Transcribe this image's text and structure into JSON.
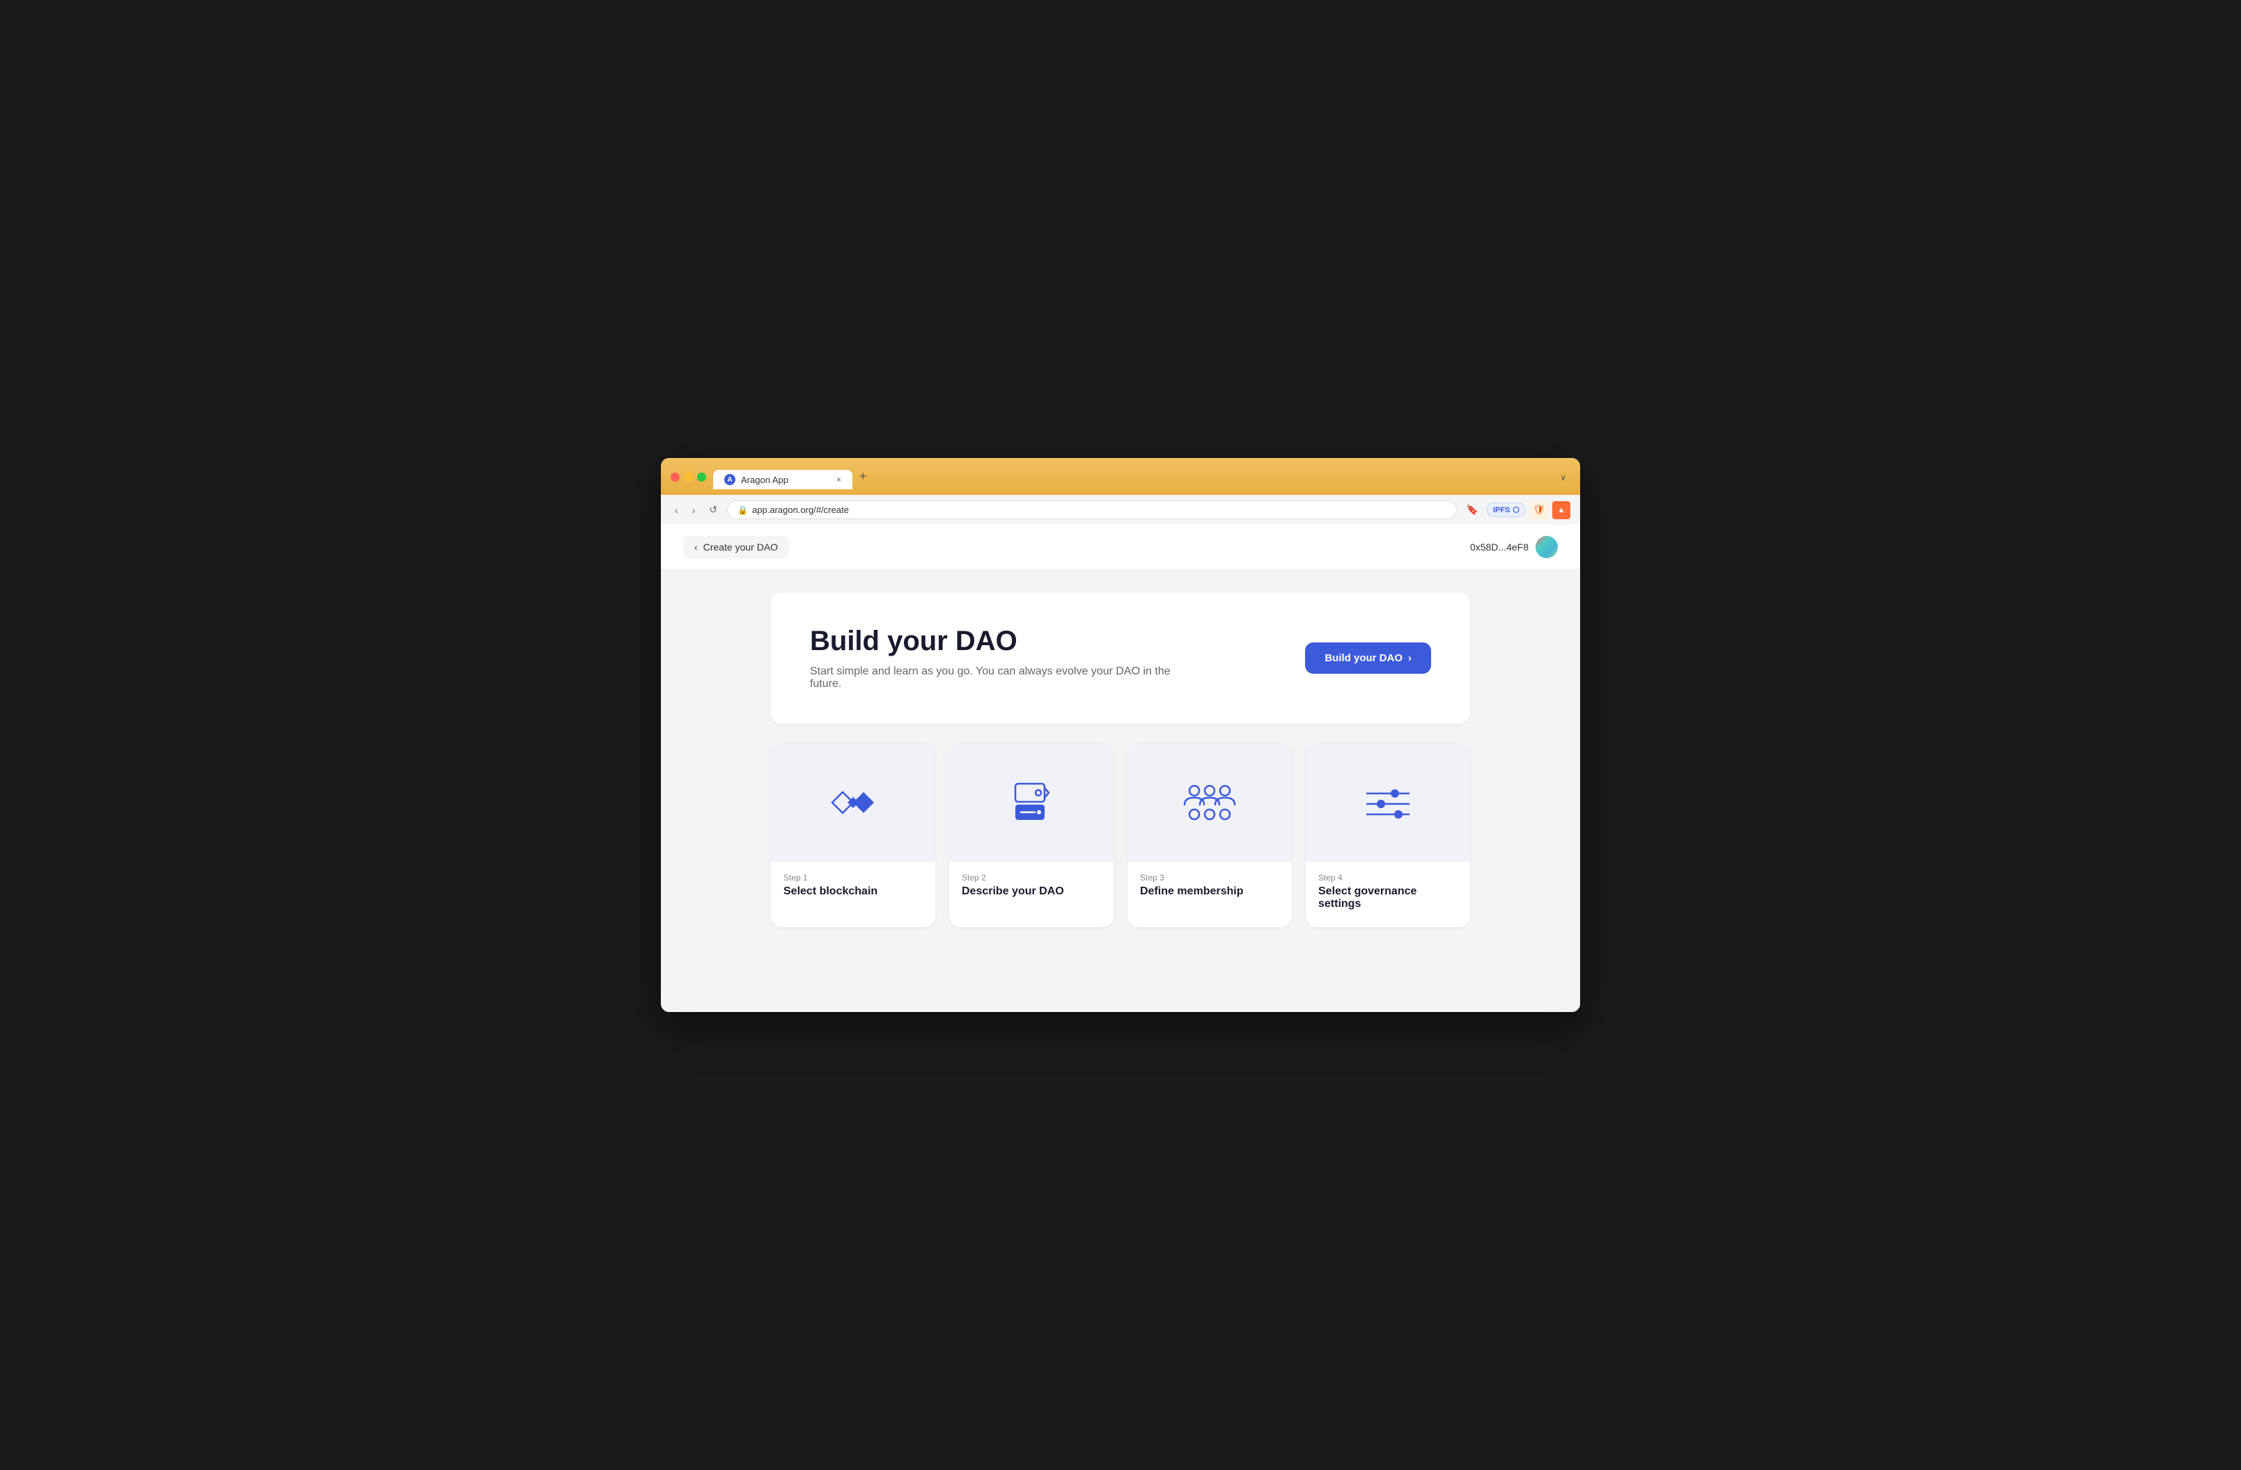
{
  "browser": {
    "tab_title": "Aragon App",
    "url": "app.aragon.org/#/create",
    "tab_close": "×",
    "tab_new": "+",
    "tab_expand": "∨",
    "ipfs_label": "IPFS",
    "nav": {
      "back": "‹",
      "forward": "›",
      "refresh": "↺"
    }
  },
  "app": {
    "back_button": "Create your DAO",
    "wallet_address": "0x58D...4eF8"
  },
  "hero": {
    "title": "Build your DAO",
    "description": "Start simple and learn as you go. You can always evolve your DAO in the future.",
    "cta_label": "Build your DAO",
    "cta_arrow": "›"
  },
  "steps": [
    {
      "number": "Step 1",
      "title": "Select blockchain",
      "icon": "blockchain-icon"
    },
    {
      "number": "Step 2",
      "title": "Describe your DAO",
      "icon": "describe-icon"
    },
    {
      "number": "Step 3",
      "title": "Define membership",
      "icon": "membership-icon"
    },
    {
      "number": "Step 4",
      "title": "Select governance settings",
      "icon": "governance-icon"
    }
  ]
}
